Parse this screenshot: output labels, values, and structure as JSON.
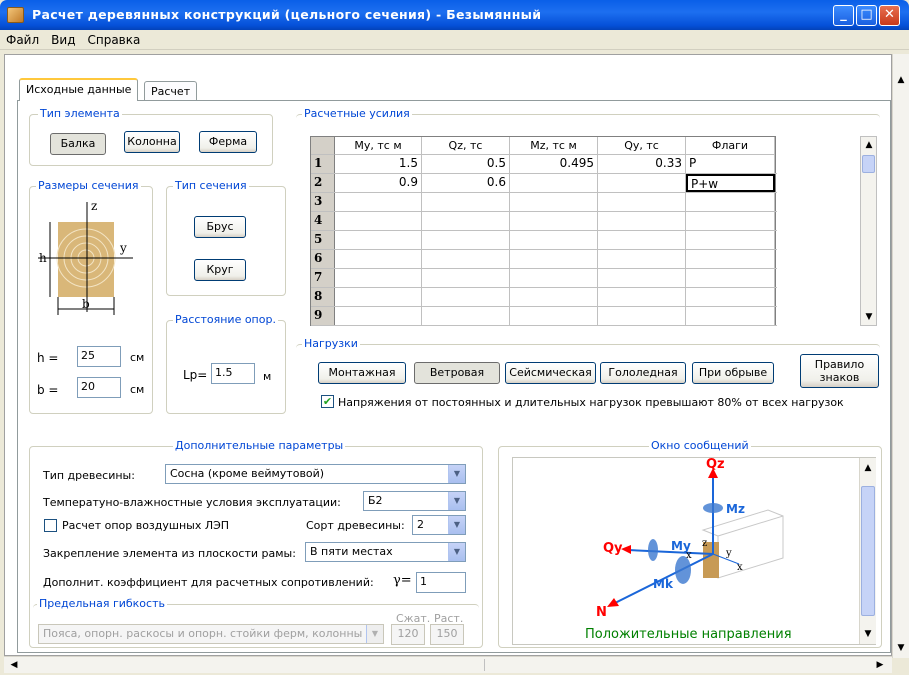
{
  "window": {
    "title": "Расчет деревянных конструкций (цельного сечения) - Безымянный"
  },
  "menu": [
    "Файл",
    "Вид",
    "Справка"
  ],
  "tabs": [
    "Исходные данные",
    "Расчет"
  ],
  "element_type": {
    "legend": "Тип элемента",
    "buttons": [
      "Балка",
      "Колонна",
      "Ферма"
    ]
  },
  "section_size": {
    "legend": "Размеры сечения",
    "h_label": "h =",
    "h_value": "25",
    "b_label": "b =",
    "b_value": "20",
    "unit": "см"
  },
  "section_type": {
    "legend": "Тип сечения",
    "buttons": [
      "Брус",
      "Круг"
    ]
  },
  "support_distance": {
    "legend": "Расстояние опор.",
    "label": "Lp=",
    "value": "1.5",
    "unit": "м"
  },
  "forces": {
    "legend": "Расчетные усилия",
    "columns": [
      "My, тс м",
      "Qz, тс",
      "Mz, тс м",
      "Qy, тс",
      "Флаги"
    ],
    "rows": [
      {
        "n": "1",
        "my": "1.5",
        "qz": "0.5",
        "mz": "0.495",
        "qy": "0.33",
        "flags": "P"
      },
      {
        "n": "2",
        "my": "0.9",
        "qz": "0.6",
        "mz": "",
        "qy": "",
        "flags": "P+w"
      },
      {
        "n": "3",
        "my": "",
        "qz": "",
        "mz": "",
        "qy": "",
        "flags": ""
      },
      {
        "n": "4",
        "my": "",
        "qz": "",
        "mz": "",
        "qy": "",
        "flags": ""
      },
      {
        "n": "5",
        "my": "",
        "qz": "",
        "mz": "",
        "qy": "",
        "flags": ""
      },
      {
        "n": "6",
        "my": "",
        "qz": "",
        "mz": "",
        "qy": "",
        "flags": ""
      },
      {
        "n": "7",
        "my": "",
        "qz": "",
        "mz": "",
        "qy": "",
        "flags": ""
      },
      {
        "n": "8",
        "my": "",
        "qz": "",
        "mz": "",
        "qy": "",
        "flags": ""
      },
      {
        "n": "9",
        "my": "",
        "qz": "",
        "mz": "",
        "qy": "",
        "flags": ""
      }
    ]
  },
  "loads": {
    "legend": "Нагрузки",
    "buttons": [
      "Монтажная",
      "Ветровая",
      "Сейсмическая",
      "Гололедная",
      "При обрыве"
    ],
    "sign_rule": "Правило\nзнаков",
    "checkbox_label": "Напряжения от постоянных и длительных нагрузок превышают 80% от всех нагрузок",
    "checkbox_checked": true
  },
  "extra_params": {
    "legend": "Дополнительные параметры",
    "wood_type_label": "Тип древесины:",
    "wood_type_value": "Сосна (кроме веймутовой)",
    "conditions_label": "Температуно-влажностные условия эксплуатации:",
    "conditions_value": "Б2",
    "pole_calc_label": "Расчет опор воздушных ЛЭП",
    "pole_calc_checked": false,
    "grade_label": "Сорт древесины:",
    "grade_value": "2",
    "fixing_label": "Закрепление элемента из плоскости рамы:",
    "fixing_value": "В пяти местах",
    "coef_label": "Дополнит. коэффициент для расчетных сопротивлений:",
    "gamma_label": "γ=",
    "coef_value": "1",
    "flex_legend": "Предельная гибкость",
    "flex_value": "Пояса, опорн. раскосы и опорн. стойки ферм, колонны",
    "compression_label": "Сжат.",
    "compression_value": "120",
    "tension_label": "Раст.",
    "tension_value": "150"
  },
  "messages": {
    "legend": "Окно сообщений",
    "caption": "Положительные направления",
    "axis_labels": [
      "Qz",
      "Mz",
      "Qy",
      "My",
      "z",
      "Mk",
      "N",
      "x",
      "y",
      "x"
    ]
  },
  "colors": {
    "title_bar": "#0a5fe8",
    "legend_text": "#0046d5",
    "diagram_caption": "#008000",
    "diagram_labels": "#ff0000"
  }
}
